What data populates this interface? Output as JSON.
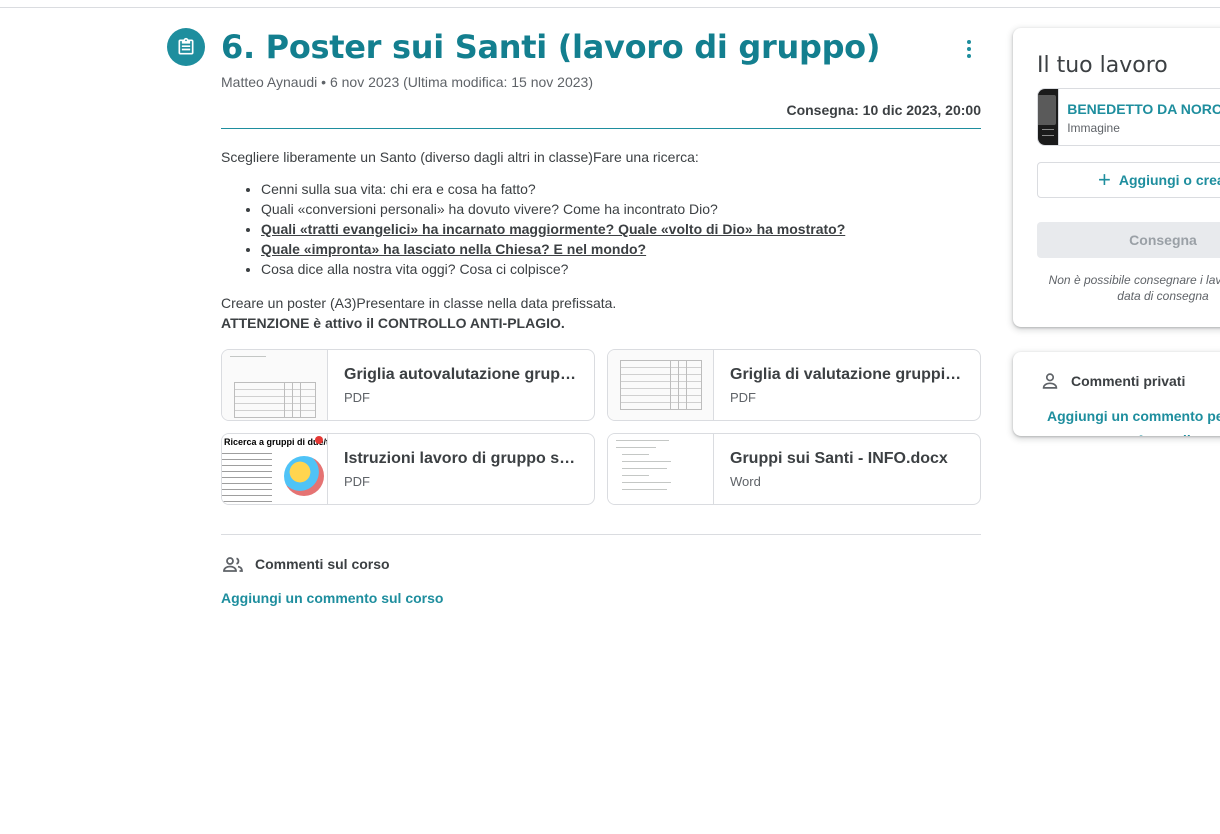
{
  "assignment": {
    "title": "6. Poster sui Santi (lavoro di gruppo)",
    "author": "Matteo Aynaudi",
    "separator": "•",
    "date": "6 nov 2023 (Ultima modifica: 15 nov 2023)",
    "due": "Consegna: 10 dic 2023, 20:00"
  },
  "description": {
    "intro": "Scegliere liberamente un Santo (diverso dagli altri in classe)Fare una ricerca:",
    "bullets": [
      "Cenni sulla sua vita: chi era e cosa ha fatto?",
      "Quali «conversioni personali» ha dovuto vivere? Come ha incontrato Dio?",
      "Quali «tratti evangelici» ha incarnato maggiormente? Quale «volto di Dio» ha mostrato?",
      "Quale «impronta» ha lasciato nella Chiesa? E nel mondo?",
      "Cosa dice alla nostra vita oggi? Cosa ci colpisce?"
    ],
    "outro": "Creare un poster (A3)Presentare in classe nella data prefissata.",
    "warning": "ATTENZIONE è attivo il CONTROLLO ANTI-PLAGIO."
  },
  "attachments": [
    {
      "title": "Griglia autovalutazione gruppi - Poster.pdf",
      "type": "PDF",
      "icon": "pdf-thumbnail"
    },
    {
      "title": "Griglia di valutazione gruppi - Poster.pdf",
      "type": "PDF",
      "icon": "pdf-thumbnail"
    },
    {
      "title": "Istruzioni lavoro di gruppo sui Santi.pdf",
      "type": "PDF",
      "icon": "poster-thumbnail"
    },
    {
      "title": "Gruppi sui Santi - INFO.docx",
      "type": "Word",
      "icon": "doc-thumbnail"
    }
  ],
  "thumb_text": {
    "poster_heading": "Ricerca a gruppi di due/tre"
  },
  "class_comments": {
    "label": "Commenti sul corso",
    "add": "Aggiungi un commento sul corso"
  },
  "your_work": {
    "title": "Il tuo lavoro",
    "file_name": "BENEDETTO DA NORCIA",
    "file_type": "Immagine",
    "add_label": "Aggiungi o crea",
    "submit_label": "Consegna",
    "late_note": "Non è possibile consegnare i lavori dopo la data di consegna"
  },
  "private_comments": {
    "label": "Commenti privati",
    "add_line1": "Aggiungi un commento per Matteo",
    "add_line2": "Aynaudi"
  },
  "colors": {
    "accent": "#1e8e9e",
    "text": "#3c4043",
    "muted": "#5f6368",
    "border": "#dadce0"
  }
}
